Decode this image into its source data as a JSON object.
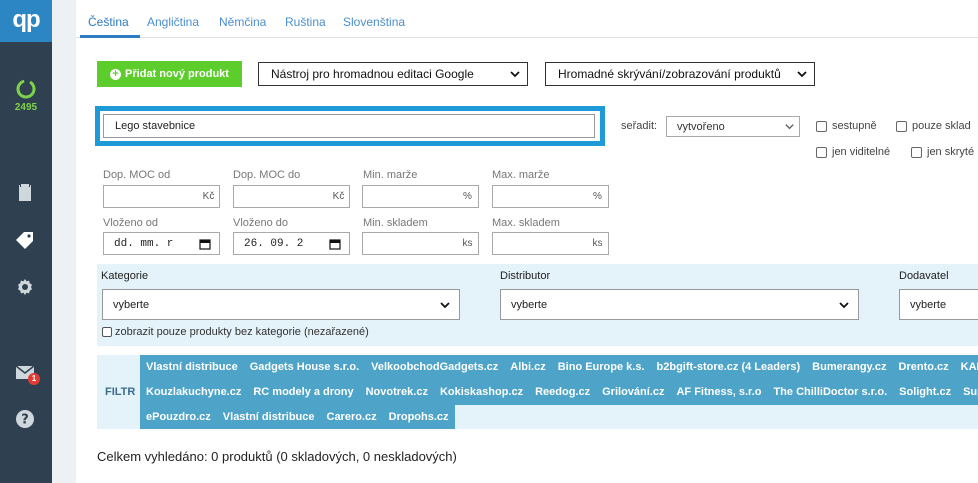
{
  "sidebar": {
    "logo": "qp",
    "ring_count": "2495",
    "mail_badge": "1"
  },
  "tabs": [
    "Čeština",
    "Angličtina",
    "Němčina",
    "Ruština",
    "Slovenština"
  ],
  "toolbar": {
    "add_button": "Přidat nový produkt",
    "google_tool": "Nástroj pro hromadnou editaci Google",
    "bulk_visibility": "Hromadné skrývání/zobrazování produktů"
  },
  "search": {
    "value": "Lego stavebnice"
  },
  "sort": {
    "label": "seřadit:",
    "value": "vytvořeno"
  },
  "checkboxes": {
    "descending": "sestupně",
    "stock_only": "pouze sklad",
    "visible_only": "jen viditelné",
    "hidden_only": "jen skryté"
  },
  "filters": {
    "moc_from": {
      "label": "Dop. MOC od",
      "unit": "Kč"
    },
    "moc_to": {
      "label": "Dop. MOC do",
      "unit": "Kč"
    },
    "margin_min": {
      "label": "Min. marže",
      "unit": "%"
    },
    "margin_max": {
      "label": "Max. marže",
      "unit": "%"
    },
    "inserted_from": {
      "label": "Vloženo od",
      "value": "dd. mm. r"
    },
    "inserted_to": {
      "label": "Vloženo do",
      "value": "26. 09. 2"
    },
    "stock_min": {
      "label": "Min. skladem",
      "unit": "ks"
    },
    "stock_max": {
      "label": "Max. skladem",
      "unit": "ks"
    }
  },
  "category": {
    "label": "Kategorie",
    "value": "vyberte",
    "uncategorized": "zobrazit pouze produkty bez kategorie (nezařazené)"
  },
  "distributor": {
    "label": "Distributor",
    "value": "vyberte"
  },
  "supplier": {
    "label": "Dodavatel",
    "value": "vyberte"
  },
  "filter_label": "FILTR",
  "filter_chips": [
    [
      "Vlastní distribuce",
      "Gadgets House s.r.o.",
      "VelkoobchodGadgets.cz",
      "Albi.cz",
      "Bino Europe k.s.",
      "b2bgift-store.cz (4 Leaders)",
      "Bumerangy.cz",
      "Drento.cz",
      "KAM"
    ],
    [
      "Kouzlakuchyne.cz",
      "RC modely a drony",
      "Novotrek.cz",
      "Kokiskashop.cz",
      "Reedog.cz",
      "Grilování.cz",
      "AF Fitness, s.r.o",
      "The ChilliDoctor s.r.o.",
      "Solight.cz",
      "Superp"
    ],
    [
      "ePouzdro.cz",
      "Vlastní distribuce",
      "Carero.cz",
      "Dropohs.cz"
    ]
  ],
  "summary": "Celkem vyhledáno: 0 produktů (0 skladových, 0 neskladových)"
}
